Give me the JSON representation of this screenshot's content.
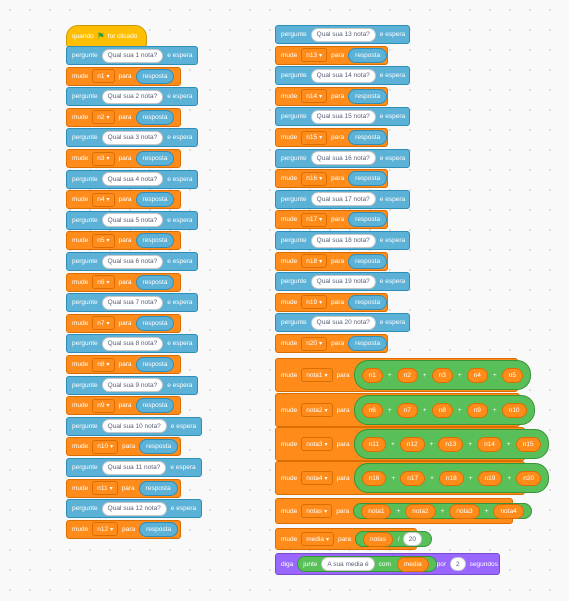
{
  "labels": {
    "when": "quando",
    "clicked": "for clicado",
    "ask": "pergunte",
    "and_wait": "e espera",
    "set": "mude",
    "to": "para",
    "answer": "resposta",
    "plus": "+",
    "divide": "/",
    "say": "diga",
    "join": "junte",
    "with": "com",
    "for": "por",
    "seconds": "segundos"
  },
  "icons": {
    "flag": "green-flag-icon"
  },
  "questions": [
    "Qual sua 1 nota?",
    "Qual sua 2 nota?",
    "Qual sua 3 nota?",
    "Qual sua 4 nota?",
    "Qual sua 5 nota?",
    "Qual sua 6 nota?",
    "Qual sua 7 nota?",
    "Qual sua 8 nota?",
    "Qual sua 9 nota?",
    "Qual sua 10 nota?",
    "Qual sua  11 nota?",
    "Qual sua 12 nota?",
    "Qual sua 13 nota?",
    "Qual sua 14 nota?",
    "Qual sua 15 nota?",
    "Qual sua 16 nota?",
    "Qual sua  17 nota?",
    "Qual sua 18 nota?",
    "Qual sua 19 nota?",
    "Qual sua 20 nota?"
  ],
  "vars": [
    "n1",
    "n2",
    "n3",
    "n4",
    "n5",
    "n6",
    "n7",
    "n8",
    "n9",
    "n10",
    "n11",
    "n12",
    "n13",
    "n14",
    "n15",
    "n16",
    "n17",
    "n18",
    "n19",
    "n20"
  ],
  "sums": [
    {
      "target": "nota1",
      "terms": [
        "n1",
        "n2",
        "n3",
        "n4",
        "n5"
      ]
    },
    {
      "target": "nota2",
      "terms": [
        "n6",
        "n7",
        "n8",
        "n9",
        "n10"
      ]
    },
    {
      "target": "nota3",
      "terms": [
        "n11",
        "n12",
        "n13",
        "n14",
        "n15"
      ]
    },
    {
      "target": "nota4",
      "terms": [
        "n16",
        "n17",
        "n18",
        "n19",
        "n20"
      ]
    }
  ],
  "notas": {
    "target": "notas",
    "terms": [
      "nota1",
      "nota2",
      "nota3",
      "nota4"
    ]
  },
  "media": {
    "target": "media",
    "numerator": "notas",
    "divisor": "20"
  },
  "say": {
    "text": "A sua media é",
    "var": "media",
    "secs": "2"
  }
}
